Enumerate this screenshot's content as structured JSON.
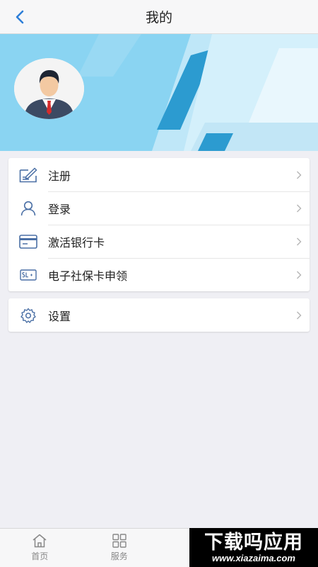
{
  "header": {
    "title": "我的"
  },
  "menu_group_1": [
    {
      "label": "注册"
    },
    {
      "label": "登录"
    },
    {
      "label": "激活银行卡"
    },
    {
      "label": "电子社保卡申领"
    }
  ],
  "menu_group_2": [
    {
      "label": "设置"
    }
  ],
  "tabbar": {
    "tabs": [
      {
        "label": "首页",
        "icon": "home-icon"
      },
      {
        "label": "服务",
        "icon": "grid-icon"
      }
    ]
  },
  "watermark": {
    "main": "下载吗应用",
    "sub": "www.xiazaima.com"
  },
  "colors": {
    "accent": "#2f7fd8",
    "banner": "#8ad4f2",
    "icon": "#4a6fa5"
  }
}
